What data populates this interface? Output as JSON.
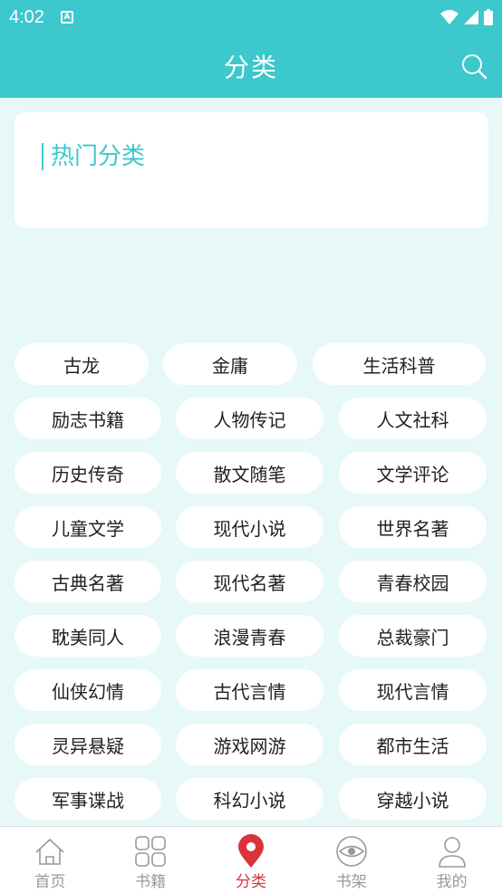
{
  "status": {
    "time": "4:02",
    "notification": "A"
  },
  "header": {
    "title": "分类"
  },
  "hot": {
    "heading": "热门分类"
  },
  "categories": [
    [
      "古龙",
      "金庸",
      "生活科普"
    ],
    [
      "励志书籍",
      "人物传记",
      "人文社科"
    ],
    [
      "历史传奇",
      "散文随笔",
      "文学评论"
    ],
    [
      "儿童文学",
      "现代小说",
      "世界名著"
    ],
    [
      "古典名著",
      "现代名著",
      "青春校园"
    ],
    [
      "耽美同人",
      "浪漫青春",
      "总裁豪门"
    ],
    [
      "仙侠幻情",
      "古代言情",
      "现代言情"
    ],
    [
      "灵异悬疑",
      "游戏网游",
      "都市生活"
    ],
    [
      "军事谍战",
      "科幻小说",
      "穿越小说"
    ]
  ],
  "tabs": [
    {
      "label": "首页",
      "icon": "home-icon",
      "active": false
    },
    {
      "label": "书籍",
      "icon": "grid-icon",
      "active": false
    },
    {
      "label": "分类",
      "icon": "location-pin-icon",
      "active": true
    },
    {
      "label": "书架",
      "icon": "eye-icon",
      "active": false
    },
    {
      "label": "我的",
      "icon": "person-icon",
      "active": false
    }
  ],
  "colors": {
    "accent": "#3cc8cc",
    "active_tab": "#d9343c",
    "background": "#e6f8f8"
  }
}
